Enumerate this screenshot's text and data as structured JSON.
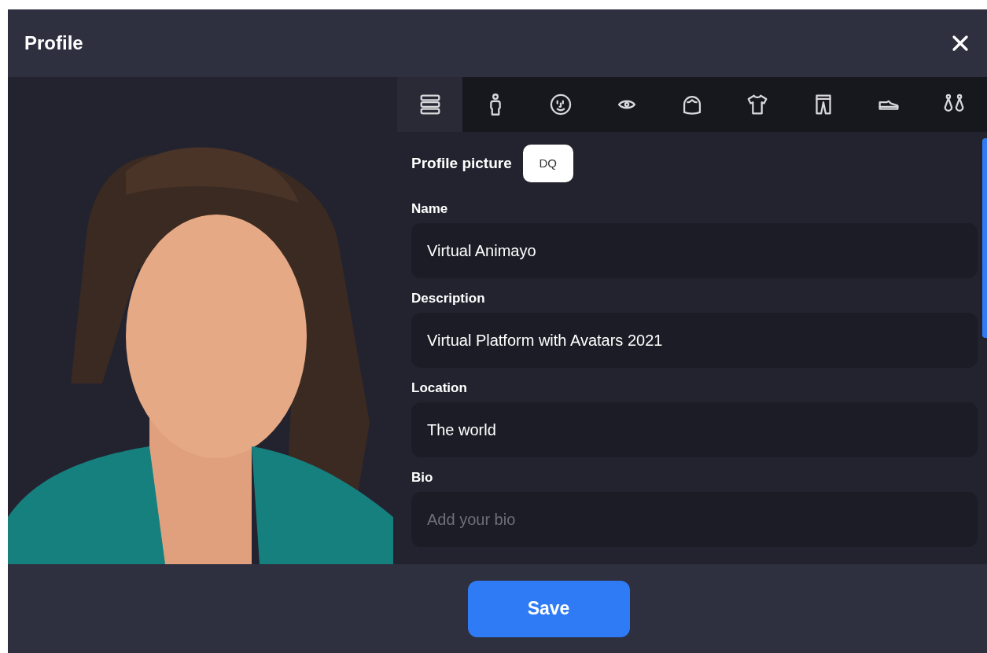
{
  "window": {
    "title": "Profile"
  },
  "tabs": [
    {
      "kind": "list",
      "selected": true
    },
    {
      "kind": "body",
      "selected": false
    },
    {
      "kind": "face",
      "selected": false
    },
    {
      "kind": "eye",
      "selected": false
    },
    {
      "kind": "hair",
      "selected": false
    },
    {
      "kind": "shirt",
      "selected": false
    },
    {
      "kind": "pants",
      "selected": false
    },
    {
      "kind": "shoe",
      "selected": false
    },
    {
      "kind": "earrings",
      "selected": false
    }
  ],
  "profile_picture": {
    "label": "Profile picture",
    "initials": "DQ"
  },
  "fields": [
    {
      "label": "Name",
      "value": "Virtual Animayo"
    },
    {
      "label": "Description",
      "value": "Virtual Platform with Avatars 2021"
    },
    {
      "label": "Location",
      "value": "The world"
    },
    {
      "label": "Bio",
      "placeholder": "Add your bio"
    }
  ],
  "buttons": [
    "Save"
  ]
}
